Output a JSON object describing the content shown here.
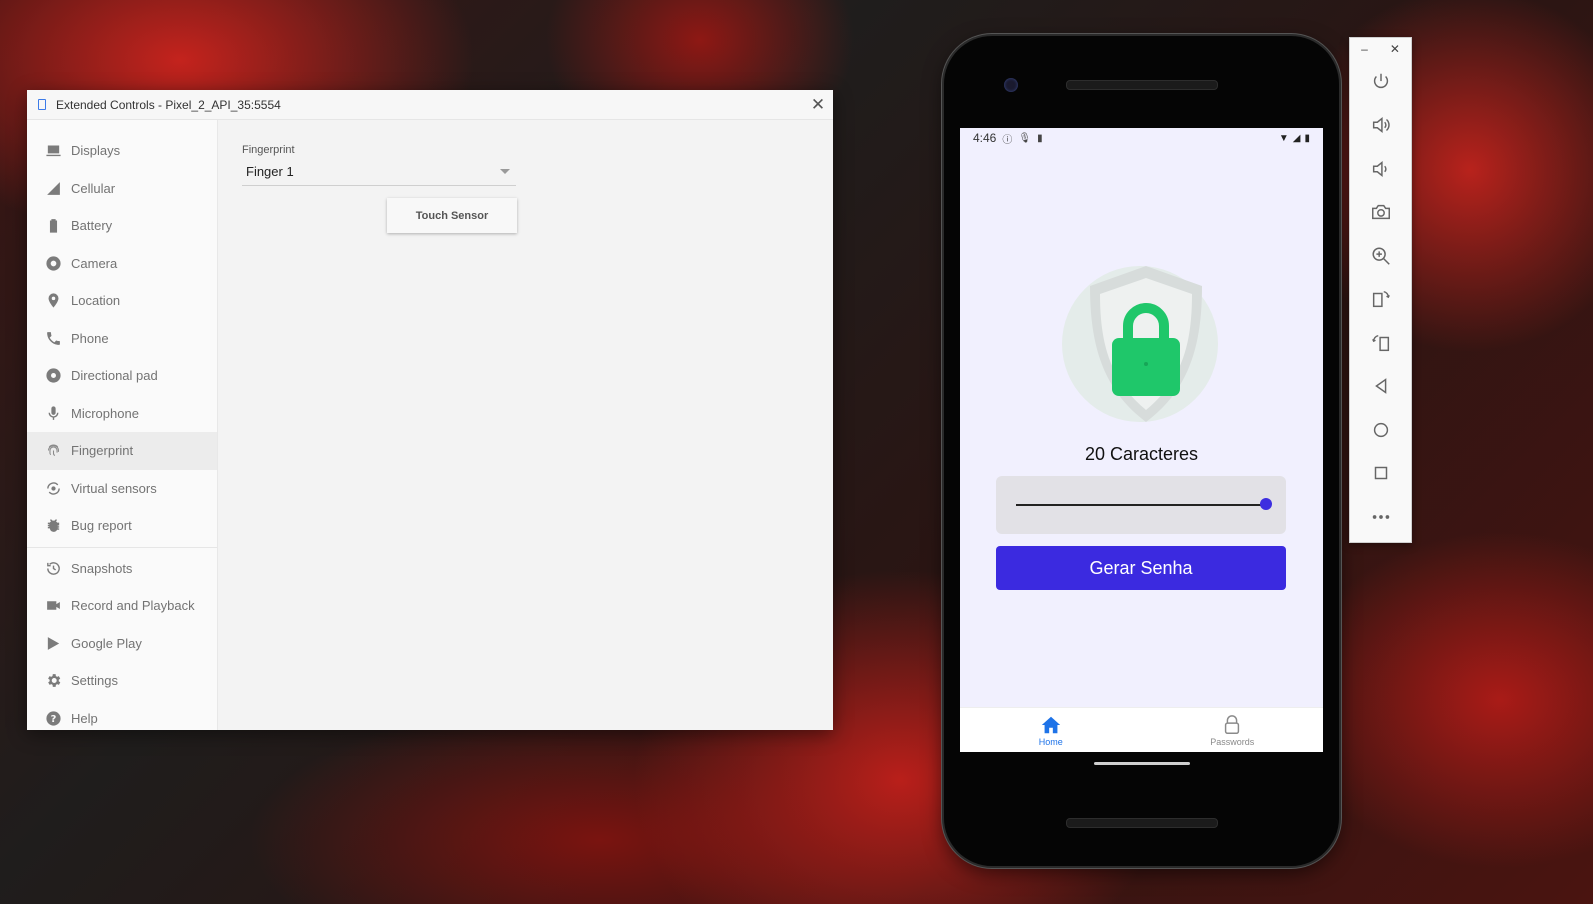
{
  "extended_controls": {
    "title": "Extended Controls - Pixel_2_API_35:5554",
    "close_label": "✕",
    "sidebar": {
      "items": [
        {
          "label": "Displays",
          "icon": "display-icon"
        },
        {
          "label": "Cellular",
          "icon": "cellular-icon"
        },
        {
          "label": "Battery",
          "icon": "battery-icon"
        },
        {
          "label": "Camera",
          "icon": "camera-aperture-icon"
        },
        {
          "label": "Location",
          "icon": "location-pin-icon"
        },
        {
          "label": "Phone",
          "icon": "phone-icon"
        },
        {
          "label": "Directional pad",
          "icon": "dpad-icon"
        },
        {
          "label": "Microphone",
          "icon": "microphone-icon"
        },
        {
          "label": "Fingerprint",
          "icon": "fingerprint-icon",
          "active": true
        },
        {
          "label": "Virtual sensors",
          "icon": "virtual-sensors-icon"
        },
        {
          "label": "Bug report",
          "icon": "bug-icon"
        },
        {
          "label": "Snapshots",
          "icon": "history-icon"
        },
        {
          "label": "Record and Playback",
          "icon": "video-camera-icon"
        },
        {
          "label": "Google Play",
          "icon": "play-icon"
        },
        {
          "label": "Settings",
          "icon": "gear-icon"
        },
        {
          "label": "Help",
          "icon": "help-icon"
        }
      ]
    },
    "fingerprint": {
      "label": "Fingerprint",
      "selected": "Finger 1",
      "button": "Touch Sensor"
    }
  },
  "phone": {
    "status": {
      "time": "4:46"
    },
    "app": {
      "char_count_label": "20 Caracteres",
      "slider_fraction": 1.0,
      "generate_button": "Gerar Senha",
      "accent_color": "#3b2ae0",
      "lock_color": "#1fc76a"
    },
    "bottom_nav": {
      "home": "Home",
      "passwords": "Passwords"
    }
  },
  "emulator_toolbar": {
    "minimize": "–",
    "close": "✕",
    "buttons": [
      "power-icon",
      "volume-up-icon",
      "volume-down-icon",
      "camera-icon",
      "zoom-icon",
      "rotate-left-icon",
      "rotate-right-icon",
      "back-icon",
      "home-icon",
      "overview-icon",
      "more-icon"
    ]
  }
}
